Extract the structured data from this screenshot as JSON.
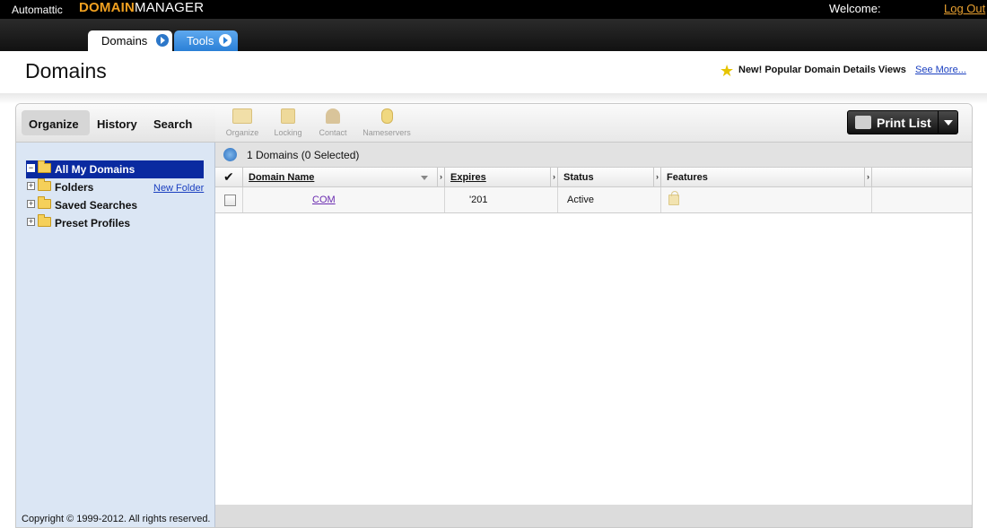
{
  "topbar": {
    "brand": "Automattic",
    "logo_bold": "DOMAIN",
    "logo_rest": "MANAGER",
    "welcome": "Welcome:",
    "logout": "Log Out"
  },
  "tabs": [
    {
      "label": "Domains",
      "active": true
    },
    {
      "label": "Tools",
      "active": false
    }
  ],
  "header": {
    "title": "Domains",
    "promo": "New! Popular Domain Details Views",
    "see_more": "See More..."
  },
  "left_tabs": [
    "Organize",
    "History",
    "Search"
  ],
  "tree": {
    "root": "All My Domains",
    "items": [
      "Folders",
      "Saved Searches",
      "Preset Profiles"
    ],
    "new_folder": "New Folder"
  },
  "toolbar": {
    "items": [
      "Organize",
      "Locking",
      "Contact",
      "Nameservers"
    ],
    "print": "Print List"
  },
  "grid": {
    "count": "1 Domains (0 Selected)",
    "columns": [
      "Domain Name",
      "Expires",
      "Status",
      "Features"
    ],
    "rows": [
      {
        "domain": "COM",
        "expires": "'201",
        "status": "Active"
      }
    ]
  },
  "footer": {
    "copyright": "Copyright © 1999-2012. All rights reserved."
  },
  "colors": {
    "accent": "#f0a020",
    "tree_selected": "#0a2aa0",
    "left_pane": "#dbe6f4",
    "link": "#1a3fc0"
  }
}
